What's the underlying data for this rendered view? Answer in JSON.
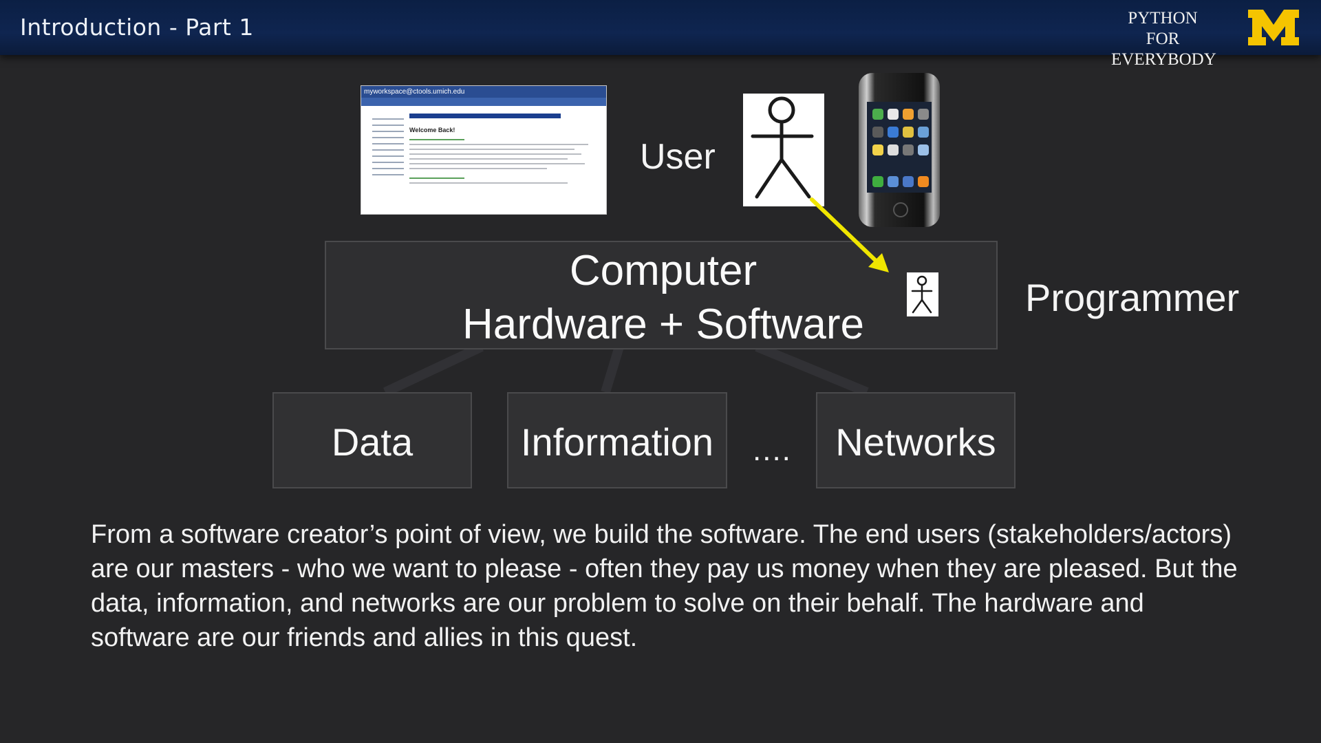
{
  "header": {
    "title": "Introduction - Part 1",
    "brand_line1": "PYTHON FOR",
    "brand_line2": "EVERYBODY",
    "logo_letter": "M",
    "colors": {
      "bar": "#0f2550",
      "logo": "#f5c400"
    }
  },
  "screenshot_thumb": {
    "header_text": "myworkspace@ctools.umich.edu",
    "welcome_text": "Welcome Back!"
  },
  "diagram": {
    "user_label": "User",
    "computer_line1": "Computer",
    "computer_line2": "Hardware + Software",
    "programmer_label": "Programmer",
    "boxes": [
      "Data",
      "Information",
      "Networks"
    ],
    "ellipsis": "....",
    "arrow_color": "#f0e600"
  },
  "body": {
    "paragraph": "From a software creator’s point of view, we build the software. The end users (stakeholders/actors) are our masters - who we want to please - often they pay us money when they are pleased. But the data, information, and networks are our problem to solve on their behalf. The hardware and software are our friends and allies in this quest."
  }
}
